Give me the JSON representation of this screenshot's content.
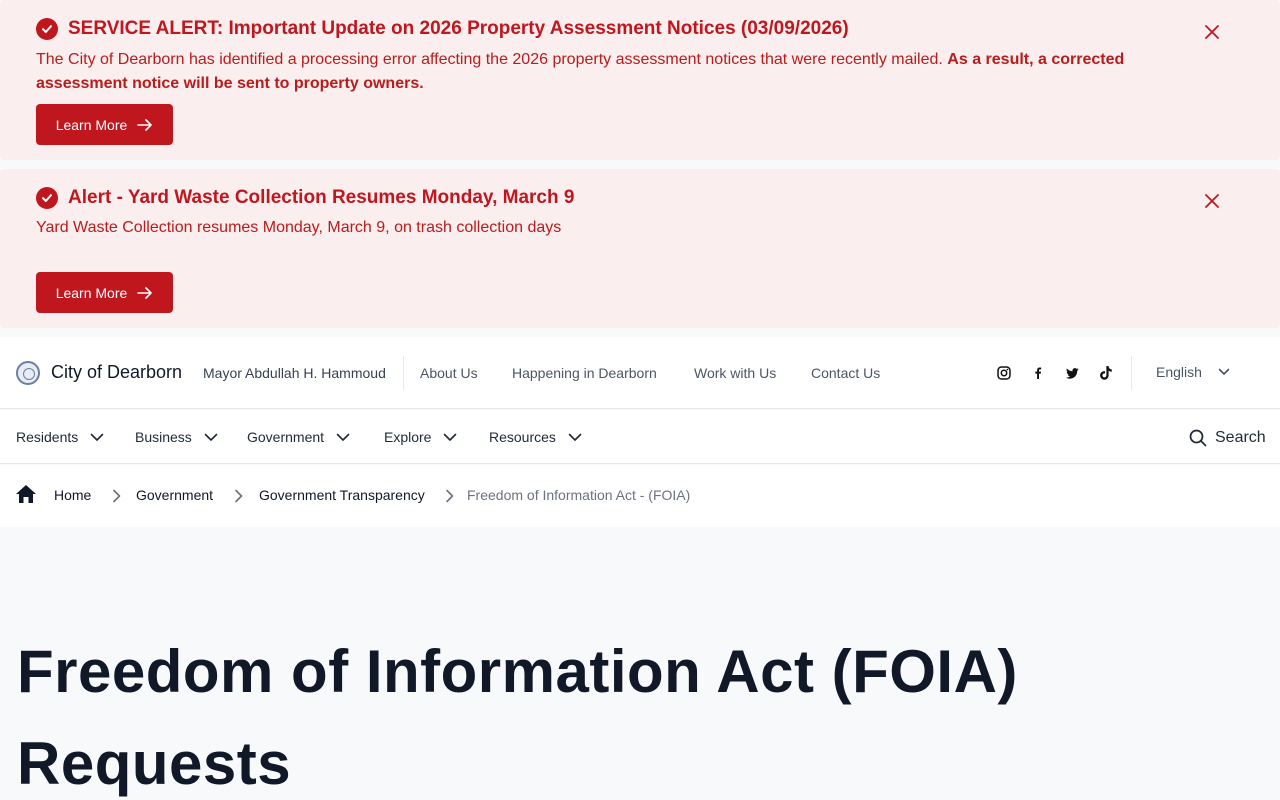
{
  "alerts": [
    {
      "title": "SERVICE ALERT: Important Update on 2026 Property Assessment Notices (03/09/2026)",
      "body": "The City of Dearborn has identified a processing error affecting the 2026 property assessment notices that were recently mailed.",
      "body_bold": "As a result, a corrected assessment notice will be sent to property owners.",
      "button": "Learn More"
    },
    {
      "title": "Alert - Yard Waste Collection Resumes Monday, March 9",
      "body": "Yard Waste Collection resumes Monday, March 9, on trash collection days",
      "body_bold": "",
      "button": "Learn More"
    }
  ],
  "header": {
    "site_name": "City of Dearborn",
    "mayor": "Mayor Abdullah H. Hammoud",
    "links": [
      "About Us",
      "Happening in Dearborn",
      "Work with Us",
      "Contact Us"
    ],
    "social_icons": [
      "instagram-icon",
      "facebook-icon",
      "twitter-icon",
      "tiktok-icon"
    ],
    "language": "English"
  },
  "nav": {
    "items": [
      "Residents",
      "Business",
      "Government",
      "Explore",
      "Resources"
    ],
    "search": "Search"
  },
  "breadcrumb": {
    "items": [
      "Home",
      "Government",
      "Government Transparency",
      "Freedom of Information Act - (FOIA)"
    ]
  },
  "page": {
    "title": "Freedom of Information Act (FOIA) Requests"
  },
  "colors": {
    "alert_bg": "#fbeeee",
    "alert_red": "#c0171f",
    "heading": "#111827"
  }
}
